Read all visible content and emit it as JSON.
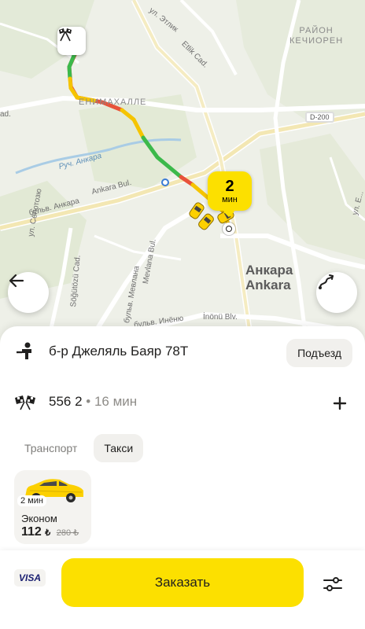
{
  "map": {
    "districts": {
      "north": "РАЙОН\nКЕЧИОРЕН",
      "center": "ЕНИМАХАЛЛЕ"
    },
    "city_ru": "Анкара",
    "city_en": "Ankara",
    "roads": {
      "ul_etlik": "ул. Этлик",
      "etlik_cad": "Etlik Cad.",
      "d200": "D-200",
      "ruch_ankara": "Руч. Анкара",
      "ankara_bul": "Ankara Bul.",
      "bulv_ankara": "бульв. Анкара",
      "ul_seguto": "ул. Сёгютозю",
      "sogutozu": "Söğütözü Cad.",
      "mevlana": "Mevlana Bul.",
      "bulv_mevlana": "бульв. Мевлана",
      "bulv_inenu": "бульв. Инёню",
      "inonu": "İnönü Blv.",
      "ul_right": "ул. Е...",
      "ad_left": "ad."
    },
    "eta_badge": {
      "value": "2",
      "unit": "мин"
    },
    "icons": {
      "start": "checkered-flags-icon",
      "back": "arrow-left-icon",
      "route": "route-icon"
    }
  },
  "sheet": {
    "pickup": {
      "address": "б-р Джеляль Баяр 78Т",
      "button": "Подъезд",
      "icon": "person-pin-icon"
    },
    "destination": {
      "address": "556 2",
      "separator": "•",
      "duration": "16 мин",
      "icon": "checkered-flags-icon",
      "add_icon": "plus-icon"
    },
    "tabs": [
      {
        "label": "Транспорт",
        "active": false
      },
      {
        "label": "Такси",
        "active": true
      }
    ],
    "tariff": {
      "eta": "2 мин",
      "name": "Эконом",
      "price": "112",
      "currency": "₺",
      "old_price": "280 ₺"
    }
  },
  "bottom": {
    "payment": "VISA",
    "order_button": "Заказать",
    "settings_icon": "sliders-icon"
  },
  "colors": {
    "accent": "#fce000",
    "route_green": "#3cb94b",
    "route_yellow": "#f5c400",
    "route_red": "#e8523a",
    "text": "#21201f"
  }
}
